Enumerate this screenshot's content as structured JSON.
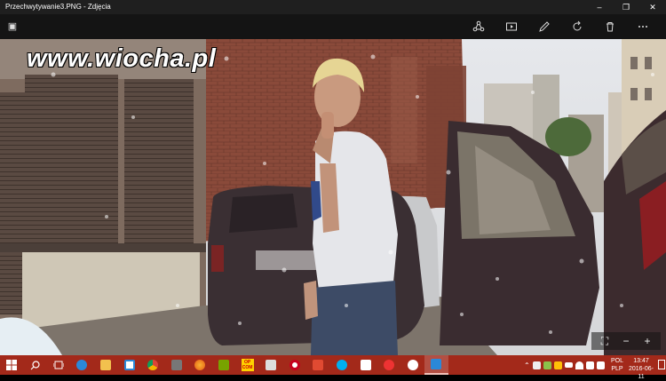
{
  "window": {
    "title": "Przechwytywanie3.PNG - Zdjęcia",
    "minimize": "–",
    "maximize": "❐",
    "close": "✕"
  },
  "watermark": "www.wiocha.pl",
  "toolbar": {
    "icons": [
      "share-icon",
      "slideshow-icon",
      "edit-icon",
      "rotate-icon",
      "delete-icon",
      "more-icon"
    ]
  },
  "zoom": {
    "fit": "⛶",
    "minus": "−",
    "plus": "+"
  },
  "taskbar": {
    "pinned_apps": [
      "edge-icon",
      "file-explorer-icon",
      "store-icon",
      "chrome-icon",
      "media-player-icon",
      "firefox-icon",
      "bittorrent-icon",
      "opcom-icon",
      "tools-icon",
      "opera-icon",
      "sketchup-icon",
      "skype-icon",
      "dropbox-icon",
      "flower-icon",
      "itunes-icon",
      "photos-icon"
    ],
    "opcom_label": "OP COM",
    "language": "POL",
    "keyboard": "PLP",
    "time": "13:47",
    "date": "2016-06-11"
  }
}
